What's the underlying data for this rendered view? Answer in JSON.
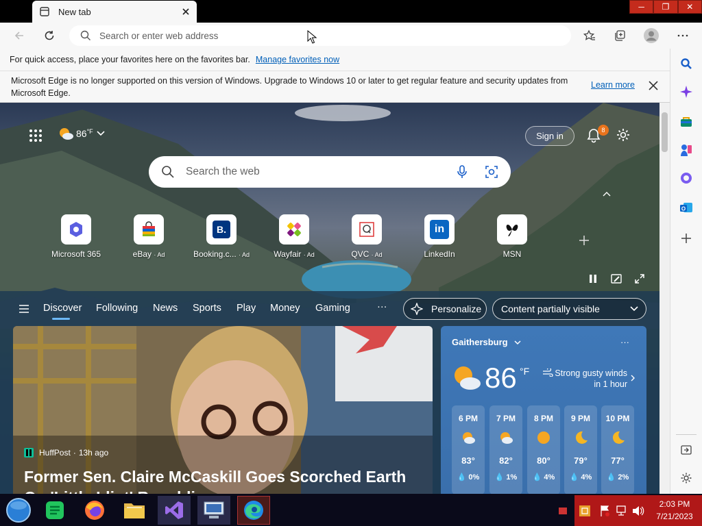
{
  "tab": {
    "title": "New tab"
  },
  "address_bar": {
    "placeholder": "Search or enter web address"
  },
  "favbar": {
    "text": "For quick access, place your favorites here on the favorites bar.",
    "link": "Manage favorites now"
  },
  "notice": {
    "message": "Microsoft Edge is no longer supported on this version of Windows. Upgrade to Windows 10 or later to get regular feature and security updates from Microsoft Edge.",
    "link": "Learn more"
  },
  "ntp": {
    "weather_mini": "86",
    "weather_mini_unit": "°F",
    "sign_in": "Sign in",
    "notif_count": "8",
    "search_placeholder": "Search the web"
  },
  "tiles": [
    {
      "label": "Microsoft 365",
      "ad": ""
    },
    {
      "label": "eBay",
      "ad": "· Ad"
    },
    {
      "label": "Booking.c...",
      "ad": "· Ad"
    },
    {
      "label": "Wayfair",
      "ad": "· Ad"
    },
    {
      "label": "QVC",
      "ad": "· Ad"
    },
    {
      "label": "LinkedIn",
      "ad": ""
    },
    {
      "label": "MSN",
      "ad": ""
    }
  ],
  "nav": {
    "items": [
      "Discover",
      "Following",
      "News",
      "Sports",
      "Play",
      "Money",
      "Gaming"
    ],
    "more": "···",
    "personalize": "Personalize",
    "content": "Content partially visible"
  },
  "news": {
    "source": "HuffPost",
    "age": "13h ago",
    "headline": "Former Sen. Claire McCaskill Goes Scorched Earth On 'Little Idiot' Republican"
  },
  "weather": {
    "location": "Gaithersburg",
    "temp": "86",
    "unit": "°F",
    "alert_line1": "Strong gusty winds",
    "alert_line2": "in 1 hour",
    "hours": [
      {
        "time": "6 PM",
        "temp": "83°",
        "precip": "0%",
        "icon": "partly-sunny-icon"
      },
      {
        "time": "7 PM",
        "temp": "82°",
        "precip": "1%",
        "icon": "partly-sunny-icon"
      },
      {
        "time": "8 PM",
        "temp": "80°",
        "precip": "4%",
        "icon": "sun-icon"
      },
      {
        "time": "9 PM",
        "temp": "79°",
        "precip": "4%",
        "icon": "moon-icon"
      },
      {
        "time": "10 PM",
        "temp": "77°",
        "precip": "2%",
        "icon": "moon-icon"
      }
    ]
  },
  "clock": {
    "time": "2:03 PM",
    "date": "7/21/2023"
  },
  "colors": {
    "accent": "#005fb8",
    "tray": "#b01818",
    "weather": "#3f78b8"
  }
}
